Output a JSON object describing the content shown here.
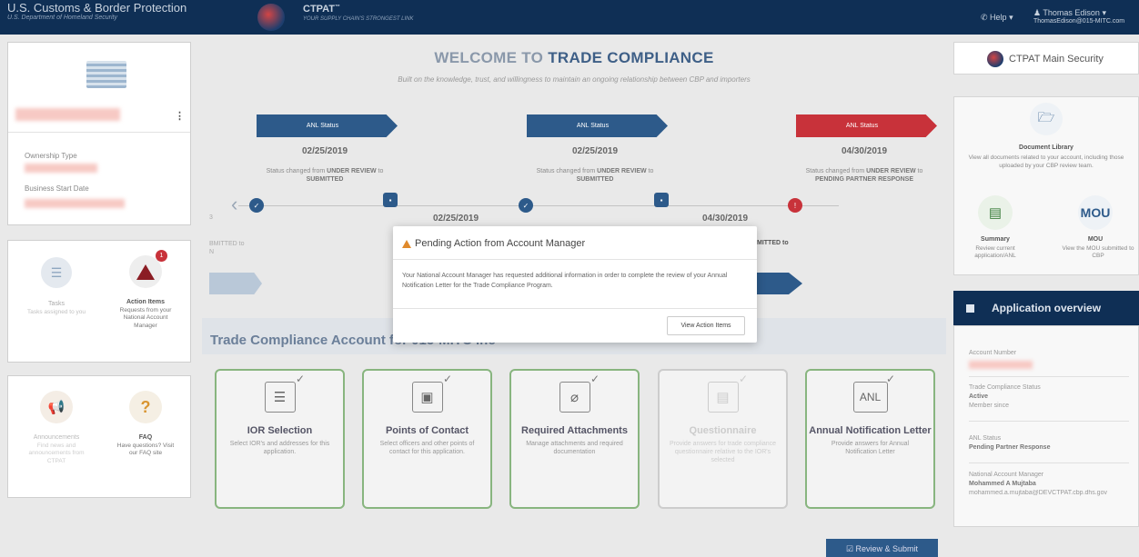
{
  "header": {
    "agency": "U.S. Customs & Border Protection",
    "dept": "U.S. Department of Homeland Security",
    "ctpat_title": "CTPAT",
    "ctpat_tagline": "YOUR SUPPLY CHAIN'S STRONGEST LINK",
    "help": "Help",
    "user_name": "Thomas Edison",
    "user_email": "ThomasEdison@015-MITC.com"
  },
  "left": {
    "ownership_label": "Ownership Type",
    "business_label": "Business Start Date",
    "tasks": {
      "label": "Tasks",
      "sub": "Tasks assigned to you"
    },
    "action_items": {
      "label": "Action Items",
      "sub": "Requests from your National Account Manager",
      "badge": "1"
    },
    "announcements": {
      "label": "Announcements",
      "sub": "Find news and announcements from CTPAT"
    },
    "faq": {
      "label": "FAQ",
      "sub": "Have questions? Visit our FAQ site"
    }
  },
  "welcome": {
    "title_a": "WELCOME TO",
    "title_b": "TRADE COMPLIANCE",
    "subtitle": "Built on the knowledge, trust, and willingness to maintain an ongoing relationship between CBP and importers"
  },
  "timeline": {
    "entries": [
      {
        "banner": "ANL Status",
        "date": "02/25/2019",
        "text_a": "Status changed from ",
        "text_b": "UNDER REVIEW",
        "text_c": " to ",
        "text_d": "SUBMITTED"
      },
      {
        "banner": "ANL Status",
        "date": "02/25/2019",
        "text_a": "Status changed from ",
        "text_b": "UNDER REVIEW",
        "text_c": " to ",
        "text_d": "SUBMITTED"
      },
      {
        "banner": "ANL Status",
        "date": "04/30/2019",
        "text_a": "Status changed from ",
        "text_b": "UNDER REVIEW",
        "text_c": " to ",
        "text_d": "PENDING PARTNER RESPONSE"
      }
    ],
    "lower_dates": [
      "02/25/2019",
      "04/30/2019"
    ],
    "lower_left_text": "BMITTED to",
    "lower_left_text2": "N",
    "lower_right_text": "MITTED to",
    "left_digit": "3"
  },
  "account_section": {
    "title": "Trade Compliance Account for 015-MITC Inc"
  },
  "cards": [
    {
      "title": "IOR Selection",
      "desc": "Select IOR's and addresses for this application.",
      "icon": "list-icon",
      "check": "✓"
    },
    {
      "title": "Points of Contact",
      "desc": "Select officers and other points of contact for this application.",
      "icon": "contact-card-icon",
      "check": "✓"
    },
    {
      "title": "Required Attachments",
      "desc": "Manage attachments and required documentation",
      "icon": "paperclip-icon",
      "check": "✓"
    },
    {
      "title": "Questionnaire",
      "desc": "Provide answers for trade compliance questionnaire relative to the IOR's selected",
      "icon": "document-icon",
      "check": "✓"
    },
    {
      "title": "Annual Notification Letter",
      "desc": "Provide answers for Annual Notification Letter",
      "icon": "anl-icon",
      "check": "✓",
      "icon_text": "ANL"
    }
  ],
  "review_button": "Review & Submit",
  "right": {
    "main_security": "CTPAT Main Security",
    "doc_library": {
      "title": "Document Library",
      "desc": "View all documents related to your account, including those uploaded by your CBP review team."
    },
    "summary": {
      "title": "Summary",
      "desc": "Review current application/ANL"
    },
    "mou": {
      "title": "MOU",
      "icon_text": "MOU",
      "desc": "View the MOU submitted to CBP"
    }
  },
  "overview": {
    "title": "Application overview",
    "account_label": "Account Number",
    "status_label": "Trade Compliance Status",
    "status_value": "Active",
    "member_label": "Member since",
    "anl_label": "ANL Status",
    "anl_value": "Pending Partner Response",
    "nam_label": "National Account Manager",
    "nam_value": "Mohammed A Mujtaba",
    "nam_email": "mohammed.a.mujtaba@DEVCTPAT.cbp.dhs.gov"
  },
  "modal": {
    "title": "Pending Action from Account Manager",
    "body": "Your National Account Manager has requested additional information in order to complete the review of your Annual Notification Letter for the Trade Compliance Program.",
    "button": "View Action Items"
  },
  "colors": {
    "navy": "#0f2f55",
    "banner_blue": "#2d5a8a",
    "banner_red": "#c8323a",
    "card_border": "#88b57f"
  }
}
